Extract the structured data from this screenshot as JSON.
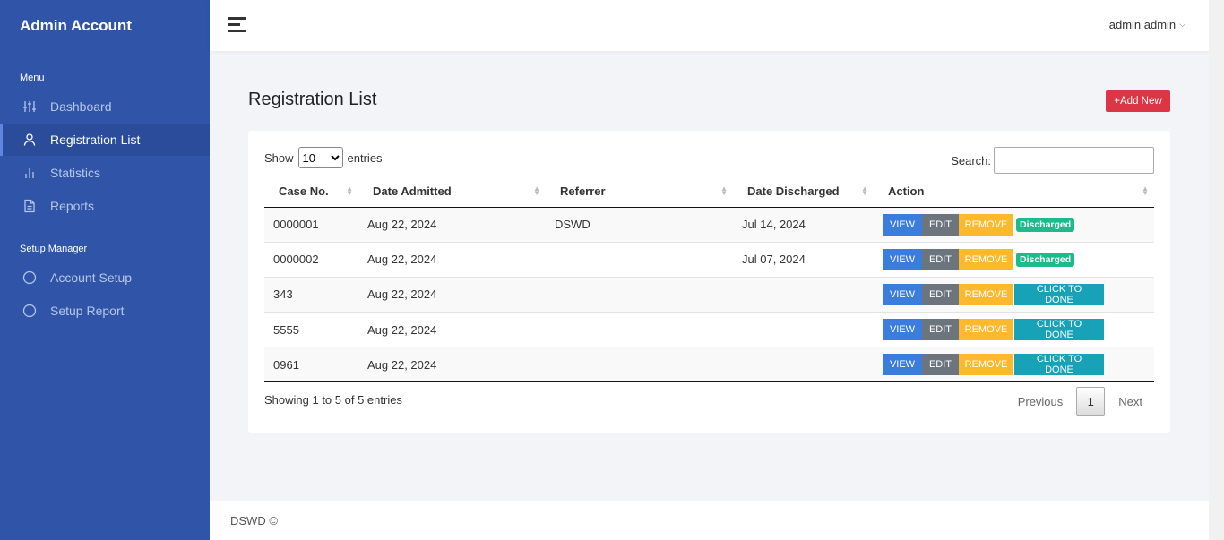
{
  "sidebar": {
    "brand": "Admin Account",
    "menu_label": "Menu",
    "items": [
      {
        "label": "Dashboard",
        "icon": "sliders-icon"
      },
      {
        "label": "Registration List",
        "icon": "user-icon"
      },
      {
        "label": "Statistics",
        "icon": "bar-chart-icon"
      },
      {
        "label": "Reports",
        "icon": "file-icon"
      }
    ],
    "setup_label": "Setup Manager",
    "setup_items": [
      {
        "label": "Account Setup",
        "icon": "circle-icon"
      },
      {
        "label": "Setup Report",
        "icon": "circle-icon"
      }
    ]
  },
  "topbar": {
    "user": "admin admin"
  },
  "page": {
    "title": "Registration List",
    "add_button": "+Add New"
  },
  "table_controls": {
    "show": "Show",
    "entries_value": "10",
    "entries": "entries",
    "search_label": "Search:"
  },
  "table": {
    "headers": [
      "Case No.",
      "Date Admitted",
      "Referrer",
      "Date Discharged",
      "Action"
    ],
    "rows": [
      {
        "case": "0000001",
        "admitted": "Aug 22, 2024",
        "referrer": "DSWD",
        "discharged": "Jul 14, 2024",
        "status": "Discharged"
      },
      {
        "case": "0000002",
        "admitted": "Aug 22, 2024",
        "referrer": "",
        "discharged": "Jul 07, 2024",
        "status": "Discharged"
      },
      {
        "case": "343",
        "admitted": "Aug 22, 2024",
        "referrer": "",
        "discharged": "",
        "status": "CLICK TO DONE"
      },
      {
        "case": "5555",
        "admitted": "Aug 22, 2024",
        "referrer": "",
        "discharged": "",
        "status": "CLICK TO DONE"
      },
      {
        "case": "0961",
        "admitted": "Aug 22, 2024",
        "referrer": "",
        "discharged": "",
        "status": "CLICK TO DONE"
      }
    ],
    "action_labels": {
      "view": "VIEW",
      "edit": "EDIT",
      "remove": "REMOVE"
    }
  },
  "pagination": {
    "info": "Showing 1 to 5 of 5 entries",
    "previous": "Previous",
    "current": "1",
    "next": "Next"
  },
  "footer": {
    "text": "DSWD ©"
  },
  "colors": {
    "sidebar": "#2f54a8",
    "danger": "#dc3545",
    "primary": "#3b7ddd",
    "secondary": "#6c757d",
    "warning": "#fcb92c",
    "info": "#17a2b8",
    "success": "#1cbb8c"
  }
}
